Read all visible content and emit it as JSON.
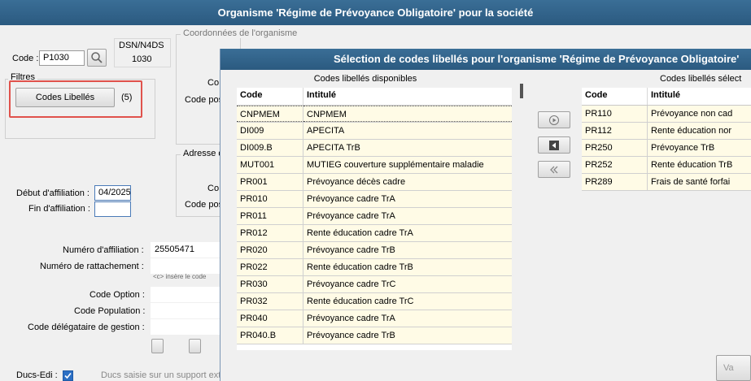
{
  "window": {
    "title": "Organisme 'Régime de Prévoyance Obligatoire' pour la société"
  },
  "form": {
    "code_label": "Code :",
    "code_value": "P1030",
    "dsn_label": "DSN/N4DS",
    "dsn_value": "1030",
    "filters_label": "Filtres",
    "codes_libelles_button": "Codes Libellés",
    "codes_libelles_count": "(5)",
    "coords_group_title": "Coordonnées de l'organisme",
    "coords_label_1": "Co",
    "coords_label_2": "Code pos",
    "adresse_group_title": "Adresse d",
    "adresse_label_1": "Co",
    "adresse_label_2": "Code pos",
    "debut_label": "Début d'affiliation :",
    "debut_value": "04/2025",
    "fin_label": "Fin d'affiliation :",
    "fin_value": "",
    "numero_affiliation_label": "Numéro d'affiliation :",
    "numero_affiliation_value": "25505471",
    "numero_rattachement_label": "Numéro de rattachement :",
    "numero_rattachement_hint": "<c> insère le code",
    "code_option_label": "Code Option :",
    "code_population_label": "Code Population :",
    "code_delegataire_label": "Code délégataire de gestion :",
    "ducs_label": "Ducs-Edi :",
    "ducs_hint": "Ducs saisie sur un support ext",
    "footer_button": "Va"
  },
  "dialog": {
    "title": "Sélection de codes libellés pour l'organisme 'Régime de Prévoyance Obligatoire'",
    "available_caption": "Codes libellés disponibles",
    "selected_caption": "Codes libellés sélect",
    "col_code": "Code",
    "col_intitule": "Intitulé",
    "available": [
      {
        "code": "CNPMEM",
        "intitule": "CNPMEM"
      },
      {
        "code": "DI009",
        "intitule": "APECITA"
      },
      {
        "code": "DI009.B",
        "intitule": "APECITA TrB"
      },
      {
        "code": "MUT001",
        "intitule": "MUTIEG couverture supplémentaire maladie"
      },
      {
        "code": "PR001",
        "intitule": "Prévoyance décès cadre"
      },
      {
        "code": "PR010",
        "intitule": "Prévoyance cadre TrA"
      },
      {
        "code": "PR011",
        "intitule": "Prévoyance cadre TrA"
      },
      {
        "code": "PR012",
        "intitule": "Rente éducation cadre TrA"
      },
      {
        "code": "PR020",
        "intitule": "Prévoyance cadre TrB"
      },
      {
        "code": "PR022",
        "intitule": "Rente éducation cadre TrB"
      },
      {
        "code": "PR030",
        "intitule": "Prévoyance cadre TrC"
      },
      {
        "code": "PR032",
        "intitule": "Rente éducation cadre TrC"
      },
      {
        "code": "PR040",
        "intitule": "Prévoyance cadre TrA"
      },
      {
        "code": "PR040.B",
        "intitule": "Prévoyance cadre TrB"
      }
    ],
    "selected": [
      {
        "code": "PR110",
        "intitule": "Prévoyance non cad"
      },
      {
        "code": "PR112",
        "intitule": "Rente éducation nor"
      },
      {
        "code": "PR250",
        "intitule": "Prévoyance TrB"
      },
      {
        "code": "PR252",
        "intitule": "Rente éducation TrB"
      },
      {
        "code": "PR289",
        "intitule": "Frais de santé forfai"
      }
    ]
  }
}
